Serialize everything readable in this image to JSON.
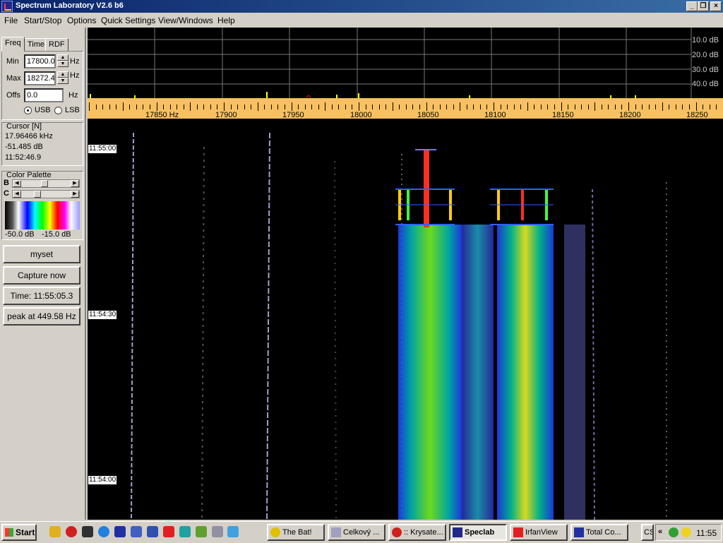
{
  "window": {
    "title": "Spectrum Laboratory V2.6 b6"
  },
  "menu": [
    "File",
    "Start/Stop",
    "Options",
    "Quick Settings",
    "View/Windows",
    "Help"
  ],
  "tabs": [
    "Freq",
    "Time",
    "RDF"
  ],
  "freq": {
    "min_label": "Min",
    "min_value": "17800.0",
    "min_unit": "Hz",
    "max_label": "Max",
    "max_value": "18272.4",
    "max_unit": "Hz",
    "offs_label": "Offs",
    "offs_value": "0.0",
    "offs_unit": "Hz",
    "usb": "USB",
    "lsb": "LSB",
    "selected": "USB"
  },
  "cursor": {
    "title": "Cursor [N]",
    "freq": "17.96466 kHz",
    "level": "-51.485 dB",
    "time": "11:52:46.9"
  },
  "palette": {
    "title": "Color Palette",
    "b": "B",
    "c": "C",
    "min": "-50.0 dB",
    "max": "-15.0 dB"
  },
  "buttons": {
    "myset": "myset",
    "capture": "Capture now",
    "time": "Time:  11:55:05.3",
    "peak": "peak at 449.58 Hz"
  },
  "spectrum": {
    "db_labels": [
      "10.0 dB",
      "20.0 dB",
      "30.0 dB",
      "40.0 dB"
    ]
  },
  "ruler": {
    "labels": [
      "17850 Hz",
      "17900",
      "17950",
      "18000",
      "18050",
      "18100",
      "18150",
      "18200",
      "18250"
    ]
  },
  "waterfall": {
    "time_labels": [
      "11:55:00",
      "11:54:30",
      "11:54:00"
    ]
  },
  "taskbar": {
    "start": "Start",
    "tasks": [
      "The Bat!",
      "Celkový ...",
      ":: Krysate...",
      "Speclab",
      "IrfanView",
      "Total Co..."
    ],
    "active_task": "Speclab",
    "tray_text": "CS",
    "clock": "11:55"
  },
  "colors": {
    "title_start": "#0a246a",
    "title_end": "#3a6ea5",
    "ruler": "#f8c060",
    "background": "#d4d0c8"
  }
}
